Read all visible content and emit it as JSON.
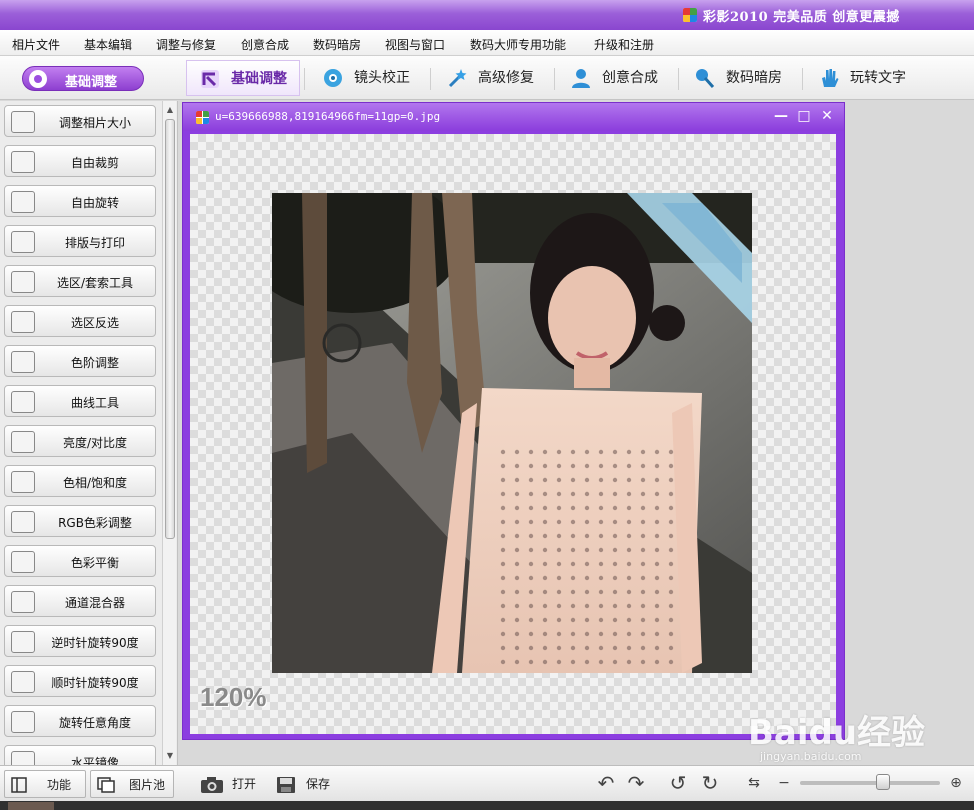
{
  "app": {
    "title": "彩影2010 完美品质 创意更震撼"
  },
  "menu": [
    "相片文件",
    "基本编辑",
    "调整与修复",
    "创意合成",
    "数码暗房",
    "视图与窗口",
    "数码大师专用功能",
    "升级和注册"
  ],
  "module_bar": {
    "current": "基础调整",
    "tabs": [
      {
        "label": "基础调整",
        "icon": "crop-arrow-icon",
        "active": true
      },
      {
        "label": "镜头校正",
        "icon": "lens-icon",
        "active": false
      },
      {
        "label": "高级修复",
        "icon": "magic-wand-icon",
        "active": false
      },
      {
        "label": "创意合成",
        "icon": "person-icon",
        "active": false
      },
      {
        "label": "数码暗房",
        "icon": "brush-icon",
        "active": false
      },
      {
        "label": "玩转文字",
        "icon": "hand-icon",
        "active": false
      }
    ]
  },
  "tools": [
    {
      "label": "调整相片大小",
      "icon": "resize-icon"
    },
    {
      "label": "自由裁剪",
      "icon": "crop-icon"
    },
    {
      "label": "自由旋转",
      "icon": "rotate-free-icon"
    },
    {
      "label": "排版与打印",
      "icon": "printer-icon"
    },
    {
      "label": "选区/套索工具",
      "icon": "lasso-icon"
    },
    {
      "label": "选区反选",
      "icon": "invert-selection-icon"
    },
    {
      "label": "色阶调整",
      "icon": "levels-icon"
    },
    {
      "label": "曲线工具",
      "icon": "curves-icon"
    },
    {
      "label": "亮度/对比度",
      "icon": "brightness-icon"
    },
    {
      "label": "色相/饱和度",
      "icon": "hue-icon"
    },
    {
      "label": "RGB色彩调整",
      "icon": "rgb-icon"
    },
    {
      "label": "色彩平衡",
      "icon": "balance-icon"
    },
    {
      "label": "通道混合器",
      "icon": "channel-mixer-icon"
    },
    {
      "label": "逆时针旋转90度",
      "icon": "rotate-ccw-icon"
    },
    {
      "label": "顺时针旋转90度",
      "icon": "rotate-cw-icon"
    },
    {
      "label": "旋转任意角度",
      "icon": "rotate-any-icon"
    },
    {
      "label": "水平镜像",
      "icon": "mirror-icon"
    }
  ],
  "image_window": {
    "filename": "u=639666988,819164966fm=11gp=0.jpg",
    "zoom": "120%"
  },
  "bottom": {
    "function_label": "功能",
    "gallery_label": "图片池",
    "open_label": "打开",
    "save_label": "保存"
  },
  "watermark": {
    "text": "Baidu经验",
    "url": "jingyan.baidu.com"
  }
}
